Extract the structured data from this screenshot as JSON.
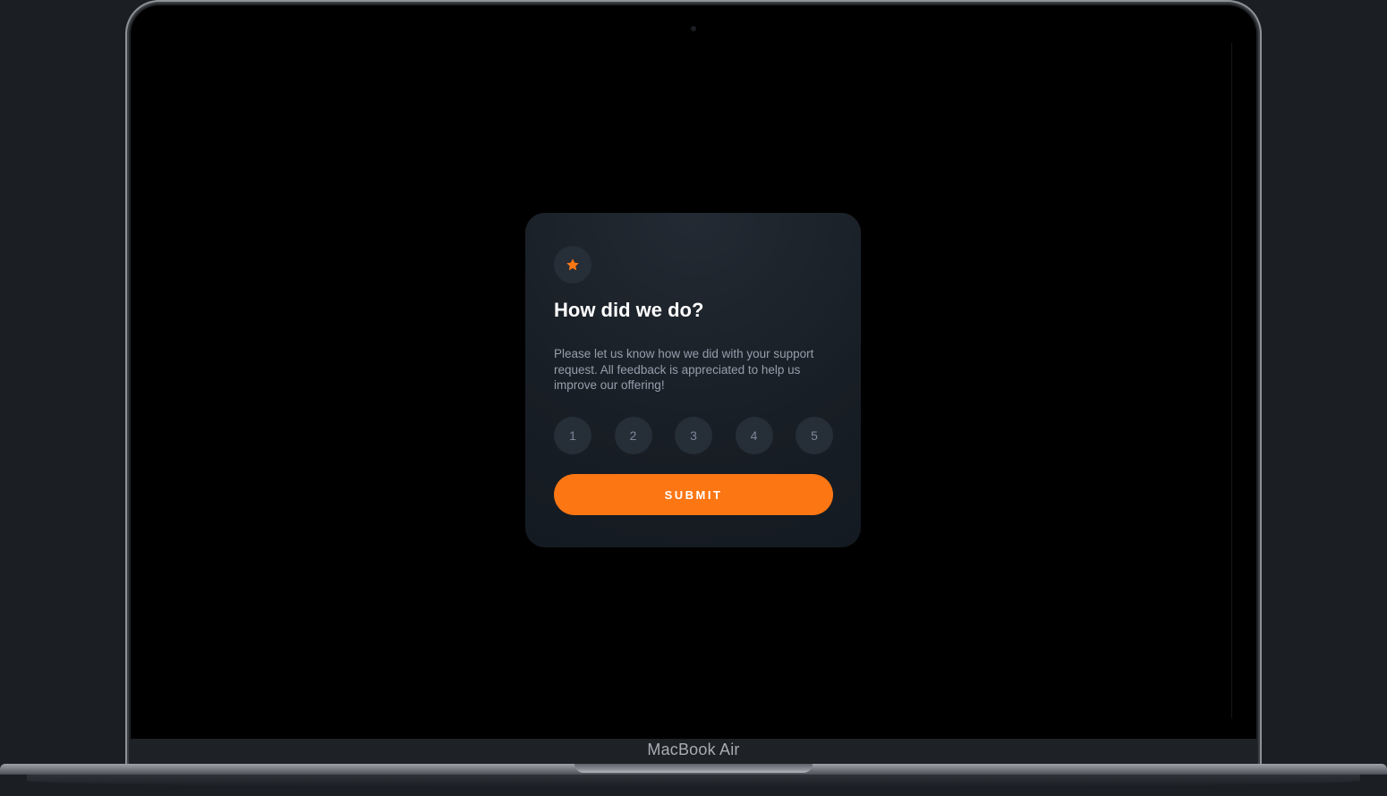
{
  "device": {
    "brand_label": "MacBook Air"
  },
  "rating_card": {
    "icon": "star-icon",
    "title": "How did we do?",
    "description_lines": [
      "Please let us know how we did with your support",
      "request. All feedback is appreciated to help us",
      "improve our offering!"
    ],
    "rating_options": [
      "1",
      "2",
      "3",
      "4",
      "5"
    ],
    "submit_label": "SUBMIT"
  },
  "colors": {
    "accent": "#fc7614",
    "card_background": "#181e25",
    "screen_background": "#000000",
    "circle_background": "#262e38",
    "muted_text": "#959eac"
  }
}
